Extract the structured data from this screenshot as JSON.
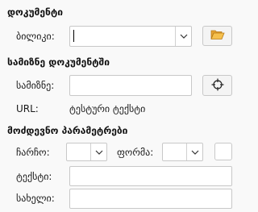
{
  "documents": {
    "title": "დოკუმენტი",
    "library_label": "ბილიკი:",
    "library_value": ""
  },
  "insert_document": {
    "title": "სამიზნე დოკუმენტში",
    "target_label": "სამიზნე:",
    "target_value": "",
    "url_label": "URL:",
    "url_value": "ტესტური ტექსტი"
  },
  "additional": {
    "title": "მოძდევნო პარამეტრები",
    "frame_label": "ჩარჩო:",
    "frame_value": "",
    "form_label": "ფორმა:",
    "form_value": "",
    "text_label": "ტექსტი:",
    "text_value": "",
    "name_label": "სახელი:",
    "name_value": ""
  },
  "icons": {
    "open_folder": "folder-open-icon",
    "target_picker": "crosshair-target-icon",
    "dropdown": "chevron-down-icon"
  }
}
